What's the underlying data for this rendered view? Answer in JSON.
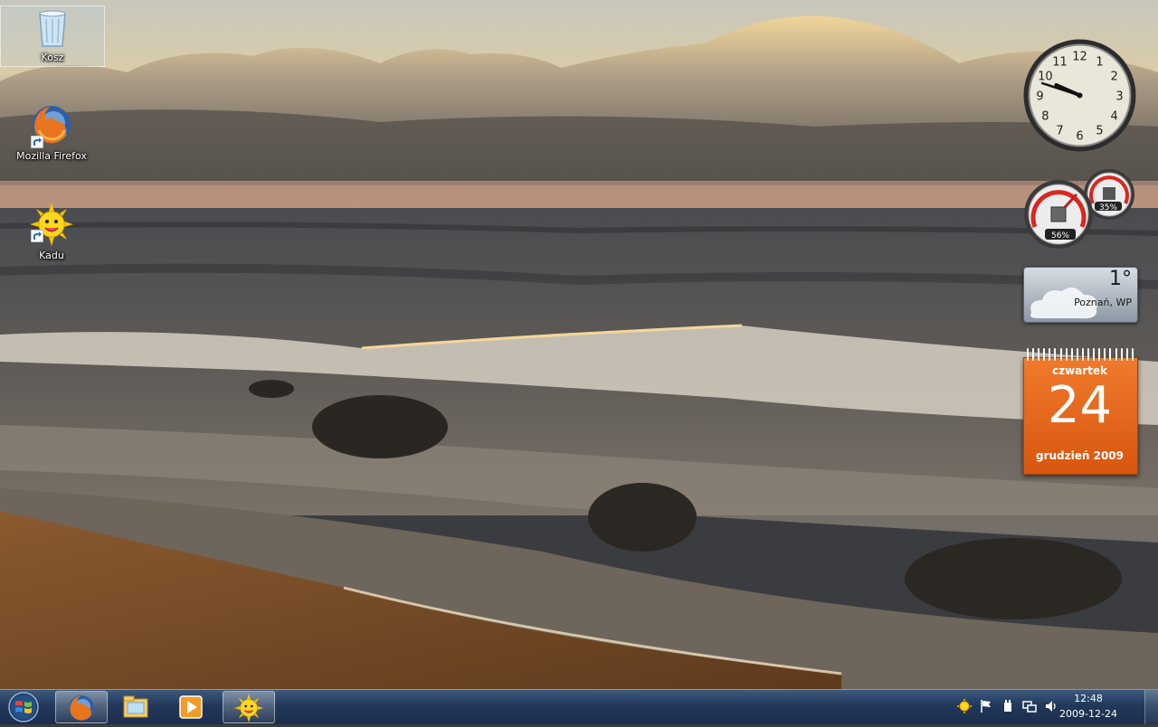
{
  "desktop": {
    "icons": [
      {
        "label": "Kosz",
        "icon": "recycle-bin-icon"
      },
      {
        "label": "Mozilla Firefox",
        "icon": "firefox-icon"
      },
      {
        "label": "Kadu",
        "icon": "kadu-sun-icon"
      }
    ]
  },
  "gadgets": {
    "clock": {
      "hour": 9,
      "minute": 48,
      "numerals": [
        "1",
        "2",
        "3",
        "4",
        "5",
        "6",
        "7",
        "8",
        "9",
        "10",
        "11",
        "12"
      ]
    },
    "cpu_meter": {
      "cpu_percent": "56%",
      "memory_percent": "35%"
    },
    "weather": {
      "temperature": "1°",
      "location": "Poznań, WP"
    },
    "calendar": {
      "weekday": "czwartek",
      "day": "24",
      "month_year": "grudzień 2009"
    }
  },
  "taskbar": {
    "start": "start-orb-icon",
    "pinned": [
      {
        "icon": "firefox-icon",
        "active": true
      },
      {
        "icon": "windows-explorer-icon",
        "active": false
      },
      {
        "icon": "media-player-icon",
        "active": false
      },
      {
        "icon": "kadu-sun-icon",
        "active": true
      }
    ],
    "tray": {
      "icons": [
        "kadu-tray-icon",
        "action-center-flag-icon",
        "power-icon",
        "network-icon",
        "volume-icon"
      ],
      "time": "12:48",
      "date": "2009-12-24"
    }
  },
  "colors": {
    "taskbar": "#22385a",
    "calendar": "#e8681f",
    "accent": "#3c5a7e"
  }
}
